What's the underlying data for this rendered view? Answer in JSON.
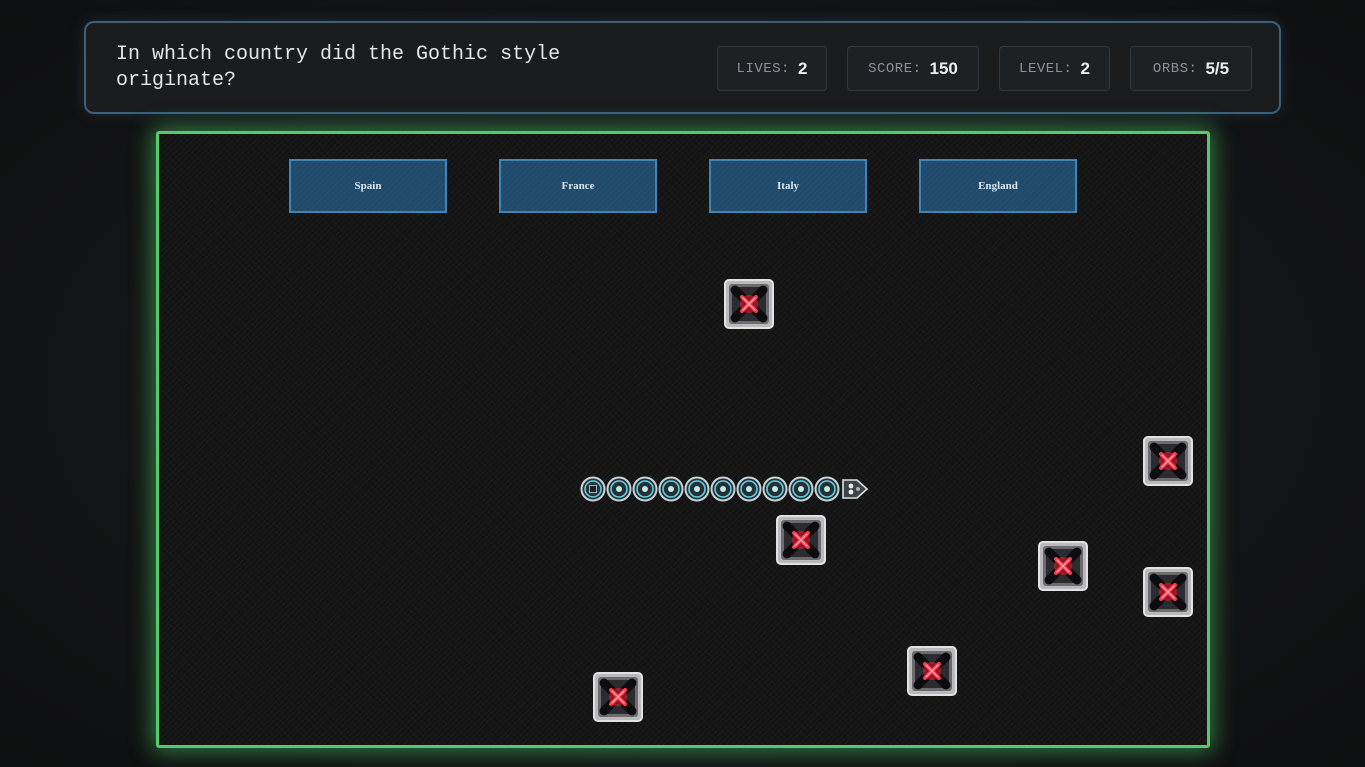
{
  "hud": {
    "question": "In which country did the Gothic style\noriginate?",
    "stats": [
      {
        "label": "LIVES:",
        "value": "2"
      },
      {
        "label": "SCORE:",
        "value": "150"
      },
      {
        "label": "LEVEL:",
        "value": "2"
      },
      {
        "label": "ORBS:",
        "value": "5/5"
      }
    ]
  },
  "board": {
    "answers": [
      "Spain",
      "France",
      "Italy",
      "England"
    ],
    "snake_segments": 10,
    "mine_count": 7,
    "colors": {
      "border": "#54c96d",
      "answer_fill": "#1f4a6b",
      "answer_border": "#3f86b8",
      "mine_x": "#ff2a3a",
      "snake_ring": "#5fd0e6"
    },
    "icons": {
      "mine": "red-x-mine-icon",
      "snake_head": "snake-head-icon",
      "snake_body": "snake-segment-icon"
    }
  }
}
